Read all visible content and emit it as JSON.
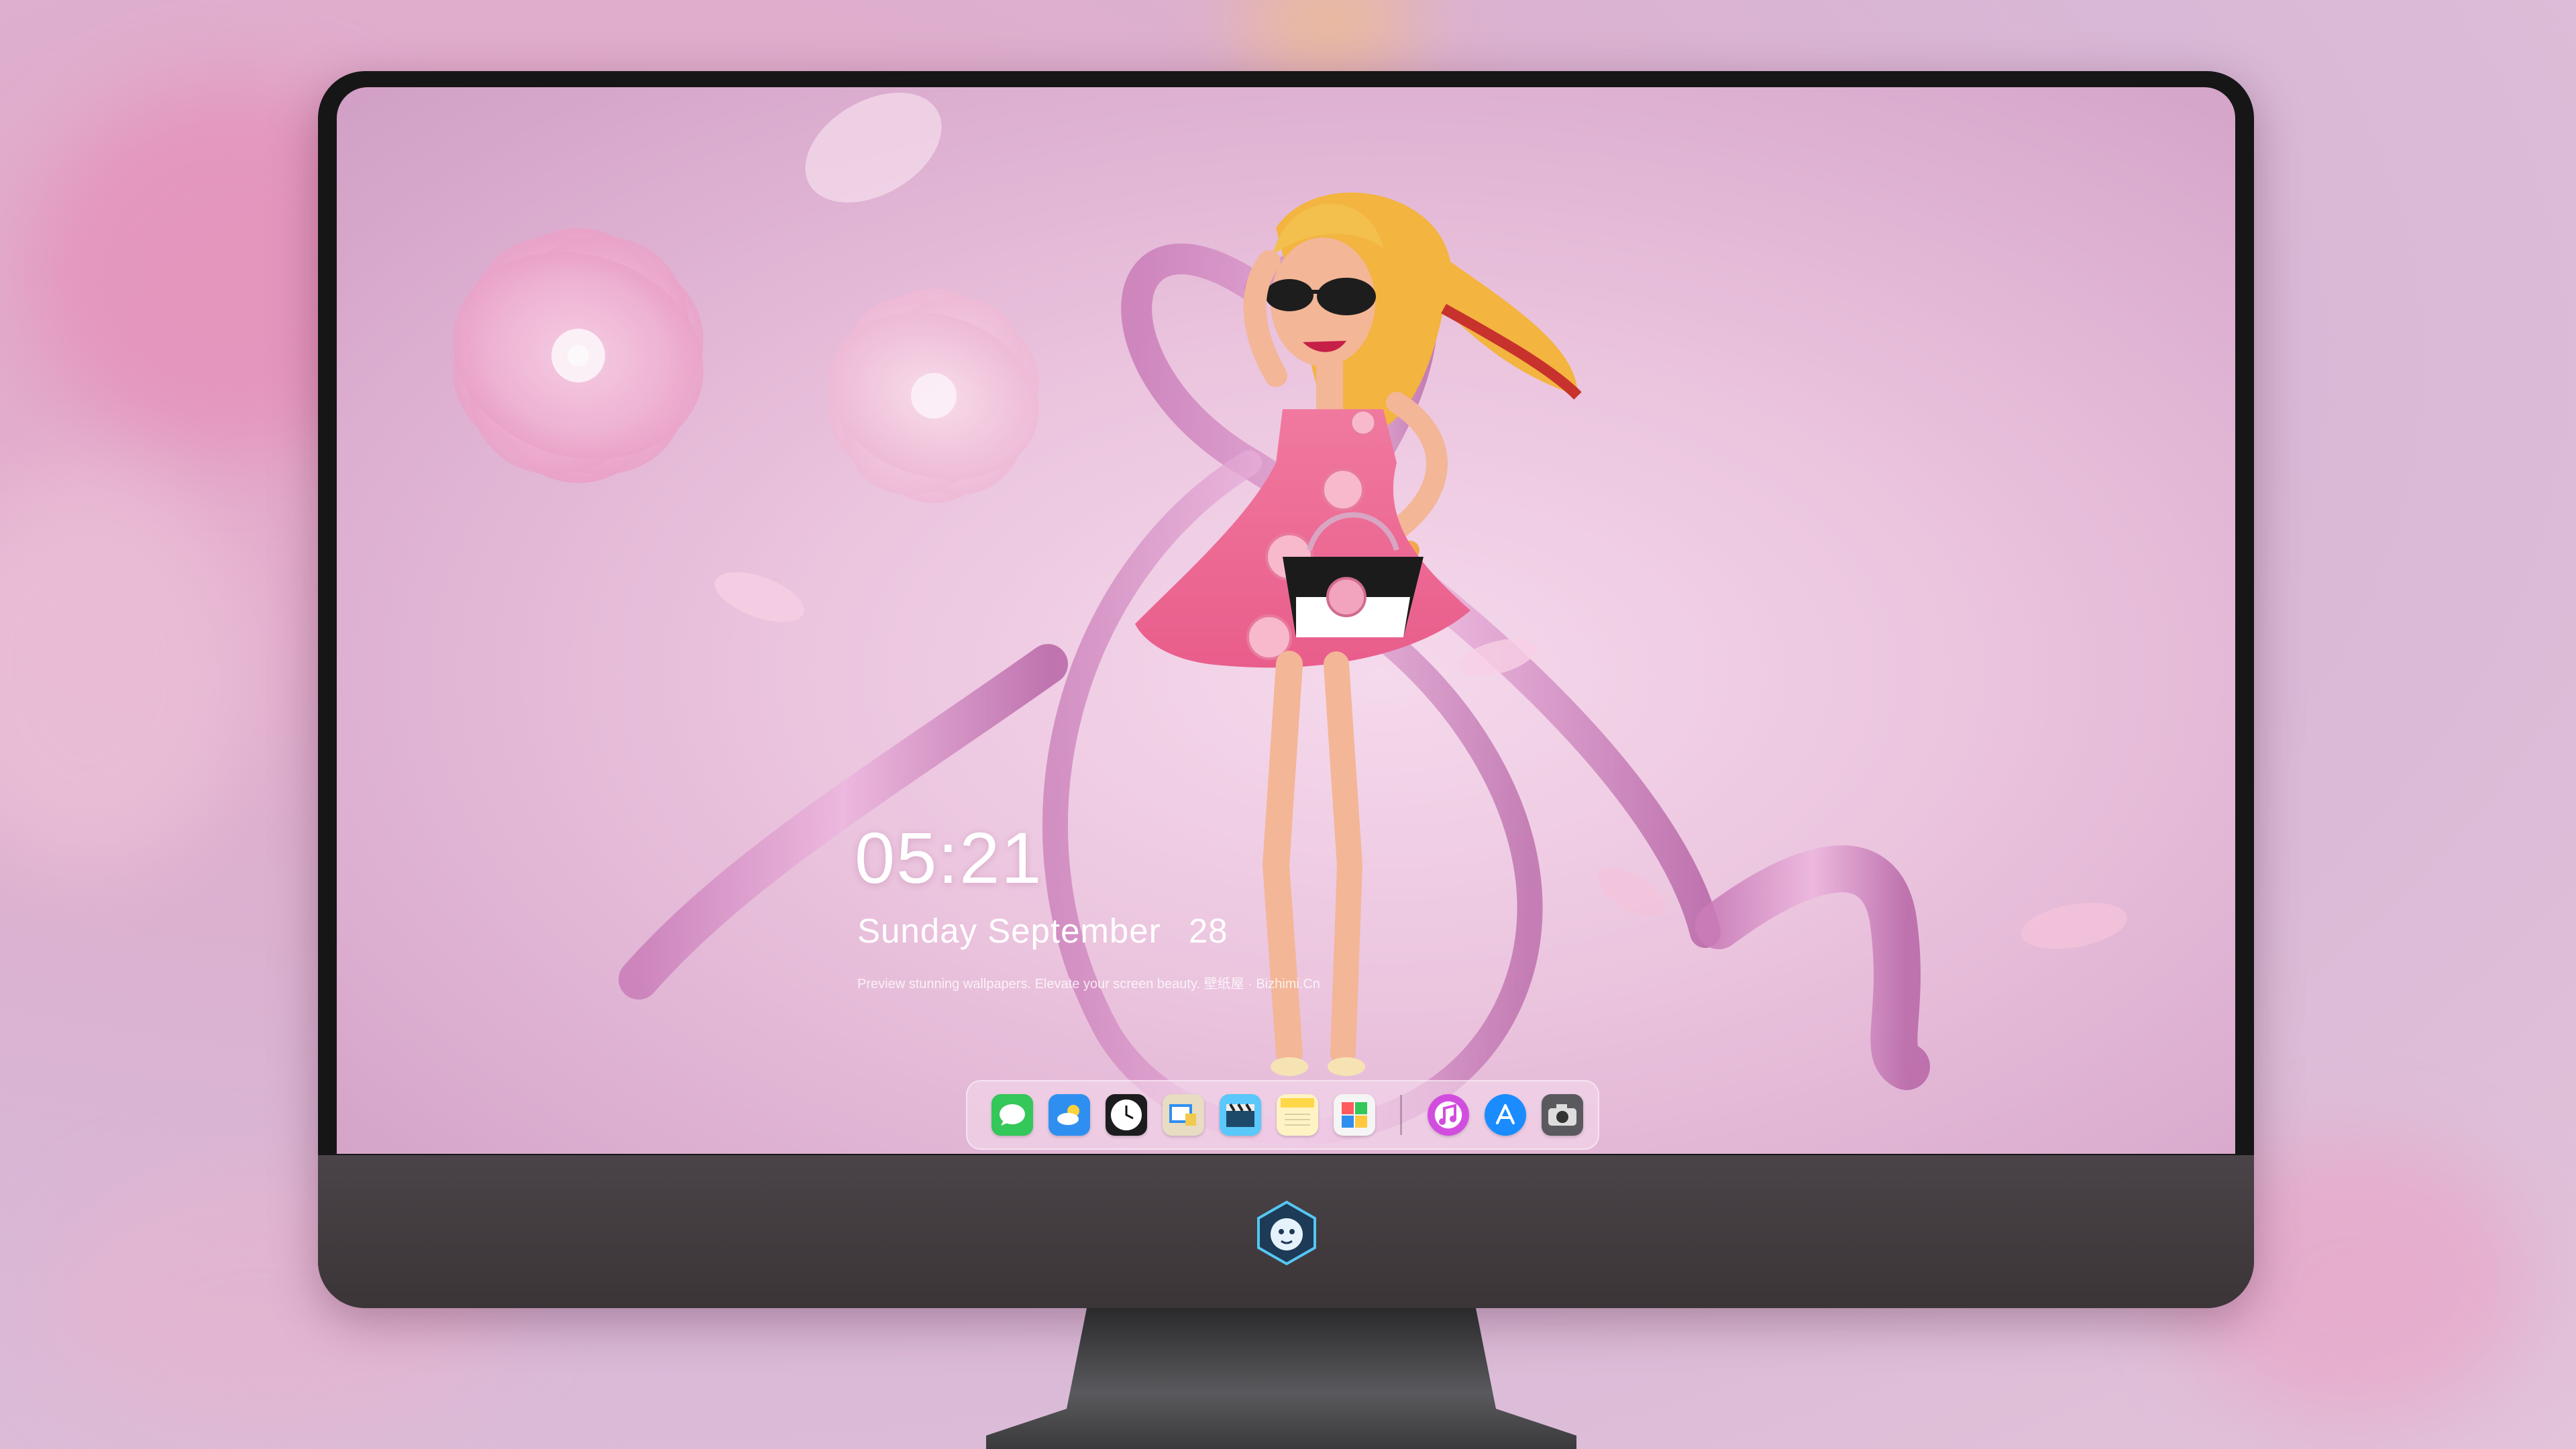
{
  "lockscreen": {
    "time": "05:21",
    "weekday": "Sunday",
    "month": "September",
    "day": "28",
    "tagline": "Preview stunning wallpapers. Elevate your screen beauty. 壁纸屋 · Bizhimi.Cn"
  },
  "dock": {
    "apps": [
      {
        "name": "messages",
        "icon": "messages-icon",
        "color": "#34c759"
      },
      {
        "name": "weather",
        "icon": "weather-icon",
        "color": "#2f8ff0"
      },
      {
        "name": "clock",
        "icon": "clock-icon",
        "color": "#1c1c1e"
      },
      {
        "name": "preview",
        "icon": "preview-icon",
        "color": "#e8dcc2"
      },
      {
        "name": "final-cut",
        "icon": "clapper-icon",
        "color": "#5ac8fa"
      },
      {
        "name": "notes",
        "icon": "notes-icon",
        "color": "#ffd84a"
      },
      {
        "name": "photo-booth",
        "icon": "photo-grid-icon",
        "color": "#f5f5f5"
      }
    ],
    "pinned": [
      {
        "name": "itunes",
        "icon": "music-note-icon",
        "color": "#d14dde"
      },
      {
        "name": "app-store",
        "icon": "app-store-icon",
        "color": "#1a8cff"
      },
      {
        "name": "screenshot",
        "icon": "camera-icon",
        "color": "#5a5a5e"
      }
    ]
  }
}
